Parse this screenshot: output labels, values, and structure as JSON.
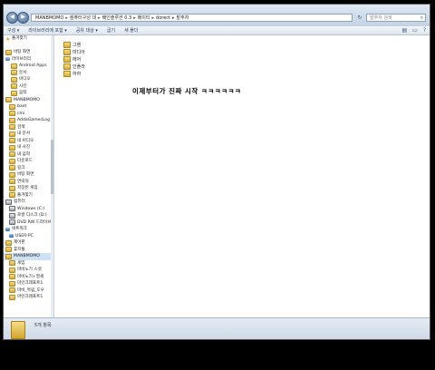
{
  "address": {
    "crumbs": [
      "MANBMOMO",
      "컴퓨터구성 대",
      "배인솔루션 0.3",
      "메이티",
      "dorect",
      "발주자"
    ],
    "search_placeholder": "발주자 검색"
  },
  "toolbar": {
    "items": [
      "구성 ▾",
      "라이브러리에 포함 ▾",
      "공유 대상 ▾",
      "굽기",
      "새 폴더"
    ]
  },
  "sidebar": {
    "items": [
      {
        "label": "즐겨찾기",
        "icon": "star"
      },
      {
        "label": "",
        "icon": ""
      },
      {
        "label": "바탕 화면",
        "icon": "folder"
      },
      {
        "label": "라이브러리",
        "icon": "library"
      },
      {
        "label": "Android Apps",
        "icon": "folder"
      },
      {
        "label": "문서",
        "icon": "folder"
      },
      {
        "label": "비디오",
        "icon": "folder"
      },
      {
        "label": "사진",
        "icon": "folder"
      },
      {
        "label": "음악",
        "icon": "folder"
      },
      {
        "label": "MANBMOMO",
        "icon": "folder"
      },
      {
        "label": "baet",
        "icon": "folder"
      },
      {
        "label": "cmi",
        "icon": "folder"
      },
      {
        "label": "AddaGamesLog",
        "icon": "folder"
      },
      {
        "label": "검색",
        "icon": "folder"
      },
      {
        "label": "내 문서",
        "icon": "folder"
      },
      {
        "label": "내 비디오",
        "icon": "folder"
      },
      {
        "label": "내 사진",
        "icon": "folder"
      },
      {
        "label": "내 음악",
        "icon": "folder"
      },
      {
        "label": "다운로드",
        "icon": "folder"
      },
      {
        "label": "링크",
        "icon": "folder"
      },
      {
        "label": "바탕 화면",
        "icon": "folder"
      },
      {
        "label": "연락처",
        "icon": "folder"
      },
      {
        "label": "저장된 게임",
        "icon": "folder"
      },
      {
        "label": "즐겨찾기",
        "icon": "folder"
      },
      {
        "label": "컴퓨터",
        "icon": "drive"
      },
      {
        "label": "Windows (C:)",
        "icon": "drive"
      },
      {
        "label": "로컬 디스크 (D:)",
        "icon": "drive"
      },
      {
        "label": "DVD RW 드라이브",
        "icon": "drive"
      },
      {
        "label": "네트워크",
        "icon": "network"
      },
      {
        "label": "USER-PC",
        "icon": "network"
      },
      {
        "label": "제어판",
        "icon": "folder"
      },
      {
        "label": "휴지통",
        "icon": "folder"
      },
      {
        "label": "MANBMOMO",
        "icon": "folder",
        "selected": true
      },
      {
        "label": "게임",
        "icon": "folder"
      },
      {
        "label": "마비노기 스샷",
        "icon": "folder"
      },
      {
        "label": "마비노기+영세",
        "icon": "folder"
      },
      {
        "label": "마인크래프트1",
        "icon": "folder"
      },
      {
        "label": "마비_목림_도우",
        "icon": "folder"
      },
      {
        "label": "마인크래프트1",
        "icon": "folder"
      }
    ]
  },
  "content": {
    "files": [
      "그랜",
      "마디아",
      "에어",
      "인플라",
      "하하"
    ],
    "overlay_text": "이제부터가 진짜 시작 ㅋㅋㅋㅋㅋㅋ"
  },
  "status": {
    "text": "5개 항목"
  }
}
